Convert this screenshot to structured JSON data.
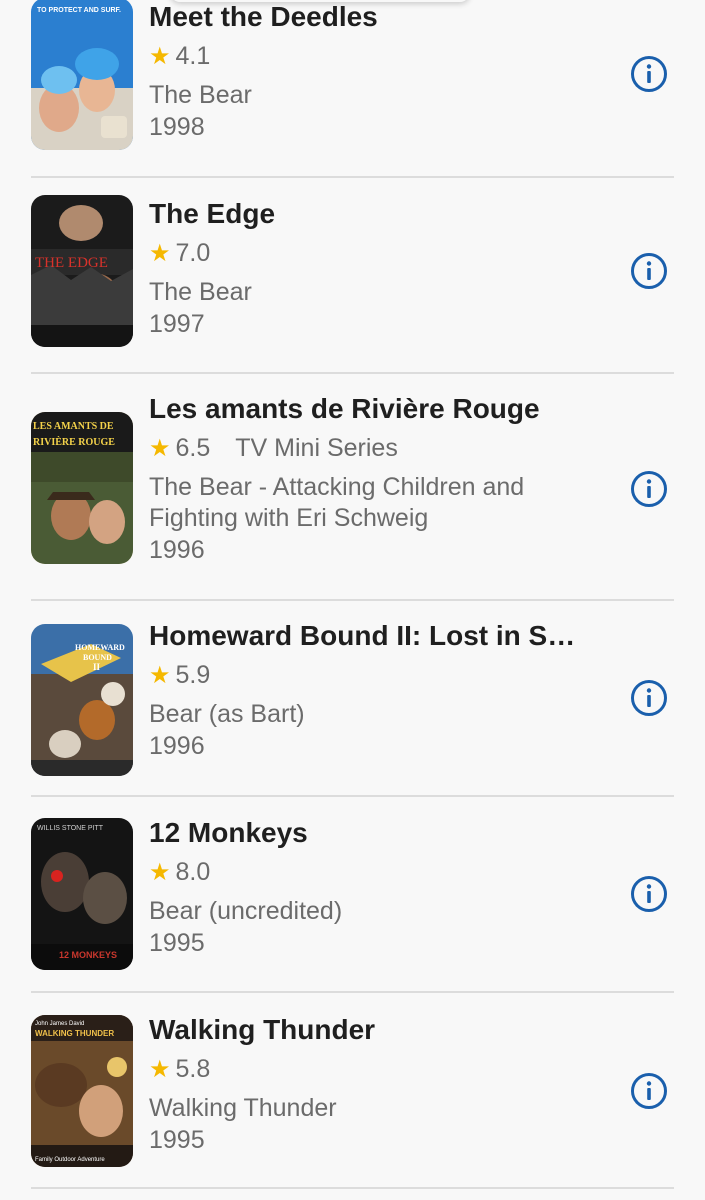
{
  "accent_color": "#1a5fac",
  "star_color": "#f5b800",
  "items": [
    {
      "title": "Meet the Deedles",
      "rating": "4.1",
      "type": "",
      "role": "The Bear",
      "year": "1998",
      "poster_text": "TO PROTECT AND SURF.",
      "icon": "info-icon"
    },
    {
      "title": "The Edge",
      "rating": "7.0",
      "type": "",
      "role": "The Bear",
      "year": "1997",
      "poster_text": "THE EDGE",
      "icon": "info-icon"
    },
    {
      "title": "Les amants de Rivière Rouge",
      "rating": "6.5",
      "type": "TV Mini Series",
      "role": "The Bear - Attacking Children and Fighting with Eri Schweig",
      "year": "1996",
      "poster_text": "LES AMANTS DE RIVIÈRE ROUGE",
      "icon": "info-icon"
    },
    {
      "title": "Homeward Bound II: Lost in S…",
      "rating": "5.9",
      "type": "",
      "role": "Bear (as Bart)",
      "year": "1996",
      "poster_text": "HOMEWARD BOUND II",
      "icon": "info-icon"
    },
    {
      "title": "12 Monkeys",
      "rating": "8.0",
      "type": "",
      "role": "Bear (uncredited)",
      "year": "1995",
      "poster_text": "12 MONKEYS",
      "icon": "info-icon"
    },
    {
      "title": "Walking Thunder",
      "rating": "5.8",
      "type": "",
      "role": "Walking Thunder",
      "year": "1995",
      "poster_text": "WALKING THUNDER",
      "icon": "info-icon"
    }
  ]
}
